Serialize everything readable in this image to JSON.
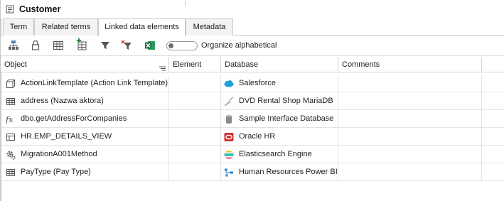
{
  "window": {
    "title": "Customer"
  },
  "tabs": [
    {
      "label": "Term",
      "active": false
    },
    {
      "label": "Related terms",
      "active": false
    },
    {
      "label": "Linked data elements",
      "active": true
    },
    {
      "label": "Metadata",
      "active": false
    }
  ],
  "toolbar": {
    "toggle_label": "Organize alphabetical",
    "toggle_on": false,
    "icons": [
      "hierarchy-icon",
      "lock-icon",
      "table-icon",
      "add-link-icon",
      "filter-icon",
      "clear-filter-icon",
      "excel-export-icon"
    ]
  },
  "grid": {
    "columns": [
      "Object",
      "Element",
      "Database",
      "Comments"
    ],
    "rows": [
      {
        "object": "ActionLinkTemplate (Action Link Template)",
        "object_icon": "object-icon",
        "element": "",
        "database": "Salesforce",
        "database_icon": "salesforce-icon",
        "comments": ""
      },
      {
        "object": "address (Nazwa aktora)",
        "object_icon": "table-icon",
        "element": "",
        "database": "DVD Rental Shop MariaDB",
        "database_icon": "mariadb-icon",
        "comments": ""
      },
      {
        "object": "dbo.getAddressForCompanies",
        "object_icon": "function-icon",
        "element": "",
        "database": "Sample Interface Database",
        "database_icon": "database-cylinder-icon",
        "comments": ""
      },
      {
        "object": "HR.EMP_DETAILS_VIEW",
        "object_icon": "view-icon",
        "element": "",
        "database": "Oracle HR",
        "database_icon": "oracle-icon",
        "comments": ""
      },
      {
        "object": "MigrationA001Method",
        "object_icon": "method-gear-icon",
        "element": "",
        "database": "Elasticsearch Engine",
        "database_icon": "elasticsearch-icon",
        "comments": ""
      },
      {
        "object": "PayType (Pay Type)",
        "object_icon": "table-icon",
        "element": "",
        "database": "Human Resources Power BI",
        "database_icon": "powerbi-icon",
        "comments": ""
      }
    ]
  },
  "colors": {
    "border": "#c9c9c9",
    "salesforce": "#1ea0db",
    "oracle": "#d32f2f",
    "excel": "#1e7145"
  }
}
